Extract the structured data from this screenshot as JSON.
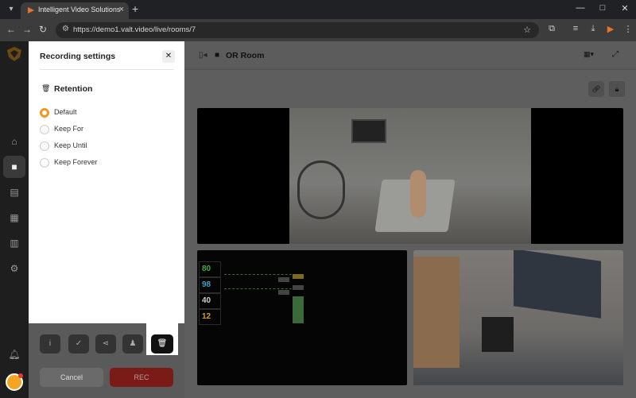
{
  "browser": {
    "tab_title": "Intelligent Video Solutions",
    "url": "https://demo1.valt.video/live/rooms/7"
  },
  "drawer": {
    "title": "Recording settings",
    "section_title": "Retention",
    "options": [
      {
        "label": "Default",
        "checked": true
      },
      {
        "label": "Keep For",
        "checked": false
      },
      {
        "label": "Keep Until",
        "checked": false
      },
      {
        "label": "Keep Forever",
        "checked": false
      }
    ],
    "cancel_label": "Cancel",
    "rec_label": "REC"
  },
  "room": {
    "title": "OR Room"
  },
  "vitals": {
    "values": [
      "80",
      "98",
      "40",
      "12"
    ],
    "colors": [
      "#3fae3f",
      "#3fa0c8",
      "#cfcfcf",
      "#e09a2a"
    ]
  },
  "colors": {
    "accent": "#f29a1f",
    "rec": "#c0281f"
  }
}
